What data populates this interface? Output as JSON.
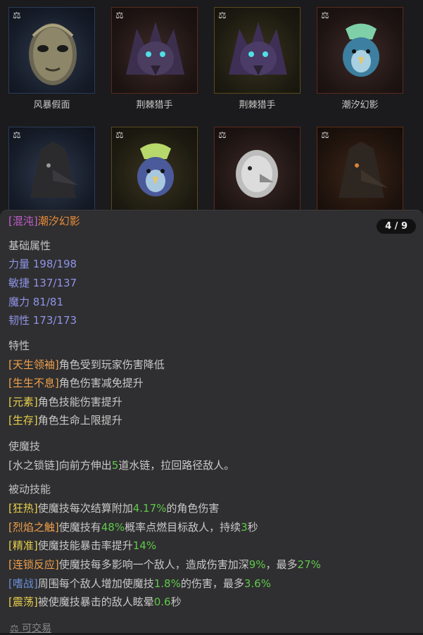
{
  "cards": [
    {
      "caption": "风暴假面",
      "badge": "balance-icon"
    },
    {
      "caption": "荆棘猎手",
      "badge": "balance-icon"
    },
    {
      "caption": "荆棘猎手",
      "badge": "balance-icon"
    },
    {
      "caption": "潮汐幻影",
      "badge": "balance-icon"
    },
    {
      "caption": "",
      "badge": "balance-icon"
    },
    {
      "caption": "",
      "badge": "balance-icon"
    },
    {
      "caption": "",
      "badge": "balance-icon"
    },
    {
      "caption": "",
      "badge": "balance-icon"
    }
  ],
  "detail": {
    "quality_tag": "[混沌]",
    "name": "潮汐幻影",
    "page": "4 / 9",
    "base_attr_title": "基础属性",
    "stats": [
      "力量 198/198",
      "敏捷 137/137",
      "魔力 81/81",
      "韧性 173/173"
    ],
    "traits_title": "特性",
    "traits": [
      {
        "tag": "[天生领袖]",
        "text": "角色受到玩家伤害降低"
      },
      {
        "tag": "[生生不息]",
        "text": "角色伤害减免提升"
      },
      {
        "tag": "[元素]",
        "text": "角色技能伤害提升"
      },
      {
        "tag": "[生存]",
        "text": "角色生命上限提升"
      }
    ],
    "magic_title": "使魔技",
    "magic": {
      "a": "[水之锁链]向前方伸出",
      "n": "5",
      "b": "道水链，拉回路径敌人。"
    },
    "passive_title": "被动技能",
    "passives": [
      {
        "tag": "[狂热]",
        "a": "使魔技每次结算附加",
        "n1": "4.17%",
        "b": "的角色伤害",
        "n2": "",
        "c": ""
      },
      {
        "tag": "[烈焰之触]",
        "a": "使魔技有",
        "n1": "48%",
        "b": "概率点燃目标敌人，持续",
        "n2": "3",
        "c": "秒"
      },
      {
        "tag": "[精准]",
        "a": "使魔技能暴击率提升",
        "n1": "14%",
        "b": "",
        "n2": "",
        "c": ""
      },
      {
        "tag": "[连锁反应]",
        "a": "使魔技每多影响一个敌人，造成伤害加深",
        "n1": "9%",
        "b": "，最多",
        "n2": "27%",
        "c": ""
      },
      {
        "tag": "[嗜战]",
        "a": "周围每个敌人增加使魔技",
        "n1": "1.8%",
        "b": "的伤害，最多",
        "n2": "3.6%",
        "c": ""
      },
      {
        "tag": "[震荡]",
        "a": "被使魔技暴击的敌人眩晕",
        "n1": "0.6",
        "b": "秒",
        "n2": "",
        "c": ""
      }
    ],
    "tradable": "可交易"
  },
  "colors": {
    "quality": "#c65fd1",
    "name": "#e88b3a",
    "stat": "#8f94e8",
    "number": "#5fc84a"
  }
}
